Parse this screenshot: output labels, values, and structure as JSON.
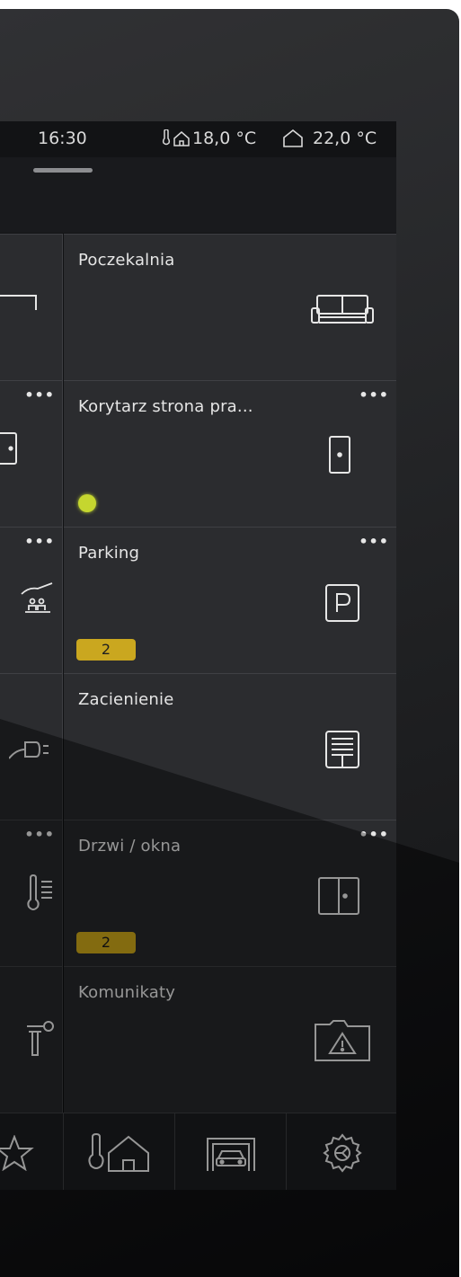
{
  "status": {
    "time": "16:30",
    "outdoor_temp": "18,0 °C",
    "indoor_temp": "22,0 °C",
    "outdoor_icon": "outdoor-temperature-icon",
    "indoor_icon": "house-icon"
  },
  "tiles": [
    {
      "label": "Poczekalnia",
      "icon": "sofa-icon",
      "menu": false
    },
    {
      "label": "Korytarz strona pra...",
      "icon": "door-icon",
      "menu": "•••",
      "indicator": "led-green"
    },
    {
      "label": "Parking",
      "icon": "parking-icon",
      "menu": "•••",
      "badge": "2"
    },
    {
      "label": "Zacienienie",
      "icon": "blind-icon",
      "menu": false
    },
    {
      "label": "Drzwi / okna",
      "icon": "window-icon",
      "menu": "•••",
      "badge": "2"
    },
    {
      "label": "Komunikaty",
      "icon": "warning-folder-icon",
      "menu": false
    }
  ],
  "left_tiles": [
    {
      "icon": "bed-icon",
      "menu": false
    },
    {
      "icon": "door-icon",
      "menu": "•••"
    },
    {
      "icon": "people-icon",
      "menu": "•••"
    },
    {
      "icon": "plug-icon",
      "menu": false
    },
    {
      "icon": "thermometer-icon",
      "menu": "•••"
    },
    {
      "icon": "sensor-icon",
      "menu": false
    }
  ],
  "navbar": [
    "favorites-star-icon",
    "outdoor-house-icon",
    "car-garage-icon",
    "settings-gear-icon"
  ],
  "colors": {
    "badge": "#c9a51a",
    "led": "#c4d62a",
    "tile": "#26272a"
  }
}
